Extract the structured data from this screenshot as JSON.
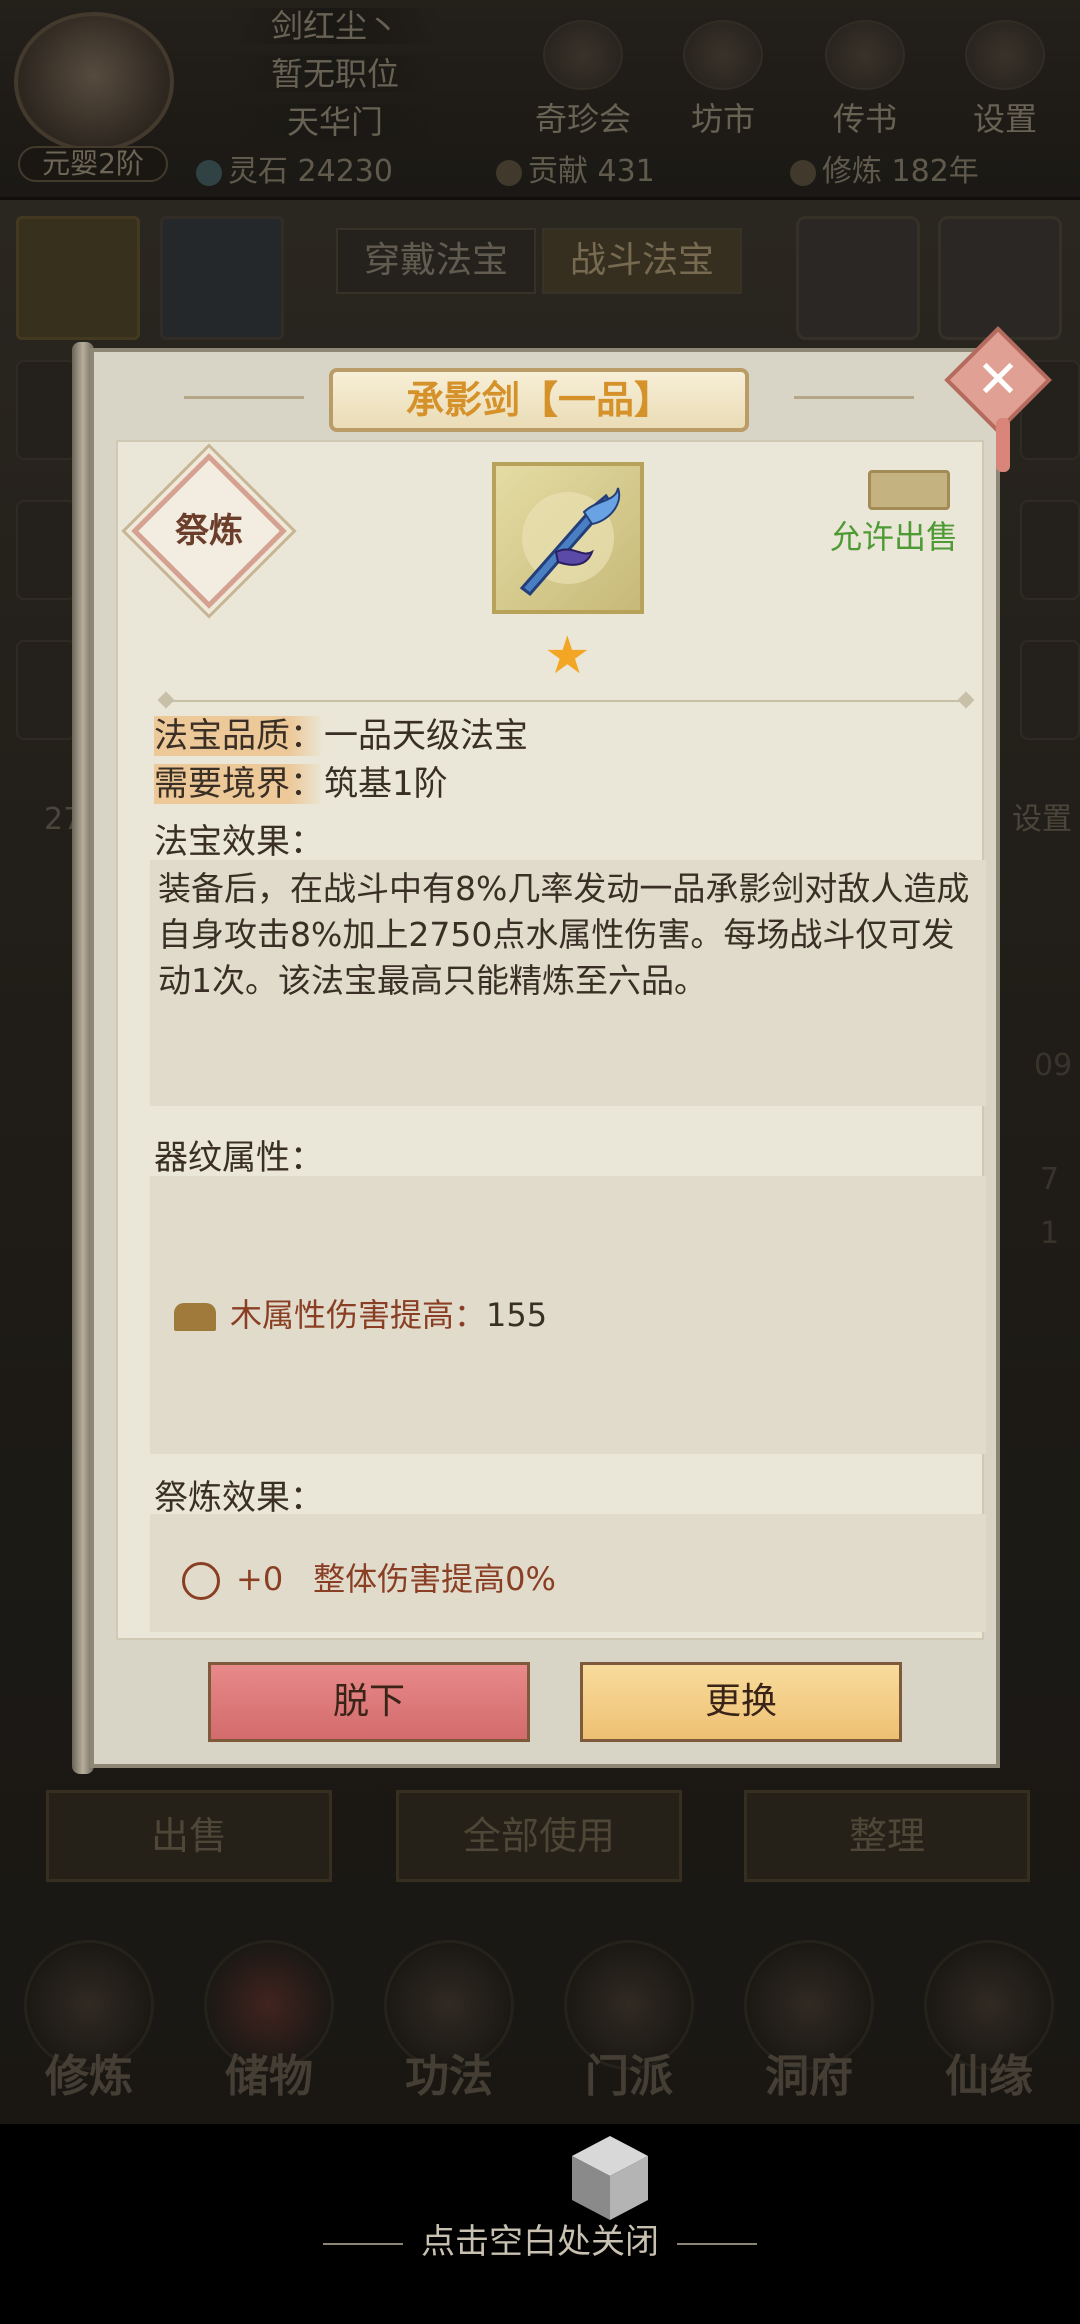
{
  "header": {
    "player_name": "剑红尘丶",
    "position": "暂无职位",
    "sect": "天华门",
    "realm": "元婴2阶",
    "icons": [
      {
        "label": "奇珍会",
        "icon": "treasure-icon"
      },
      {
        "label": "坊市",
        "icon": "market-icon"
      },
      {
        "label": "传书",
        "icon": "letter-icon"
      },
      {
        "label": "设置",
        "icon": "gear-icon"
      }
    ],
    "stats": {
      "spirit_stone_label": "灵石",
      "spirit_stone_value": "24230",
      "contribution_label": "贡献",
      "contribution_value": "431",
      "cultivation_label": "修炼",
      "cultivation_value": "182年"
    }
  },
  "tabs": [
    "穿戴法宝",
    "战斗法宝"
  ],
  "side_fragments": {
    "left_number": "27",
    "right_settings": "设置",
    "right_num_1": "09",
    "right_num_2": "7",
    "right_num_3": "1"
  },
  "bottom_actions": [
    "出售",
    "全部使用",
    "整理"
  ],
  "nav": [
    "修炼",
    "储物",
    "功法",
    "门派",
    "洞府",
    "仙缘"
  ],
  "dialog": {
    "title": "承影剑【一品】",
    "refine_label": "祭炼",
    "sell_status": "允许出售",
    "stars": 1,
    "quality_label": "法宝品质：",
    "quality_value": "一品天级法宝",
    "realm_label": "需要境界：",
    "realm_value": "筑基1阶",
    "effect_title": "法宝效果：",
    "effect_text": "装备后，在战斗中有8%几率发动一品承影剑对敌人造成自身攻击8%加上2750点水属性伤害。每场战斗仅可发动1次。该法宝最高只能精炼至六品。",
    "rune_title": "器纹属性：",
    "rune_bonus_label": "木属性伤害提高：",
    "rune_bonus_value": "155",
    "refine_effect_title": "祭炼效果：",
    "refine_level": "+0",
    "refine_effect_text": "整体伤害提高0%",
    "unequip_label": "脱下",
    "replace_label": "更换",
    "close_icon": "close-icon"
  },
  "footer_hint": "点击空白处关闭",
  "colors": {
    "title": "#d6922a",
    "sell_status": "#4e9a35",
    "bonus": "#8a3f24",
    "unequip_btn": "#d36b6c",
    "replace_btn": "#eec073"
  }
}
